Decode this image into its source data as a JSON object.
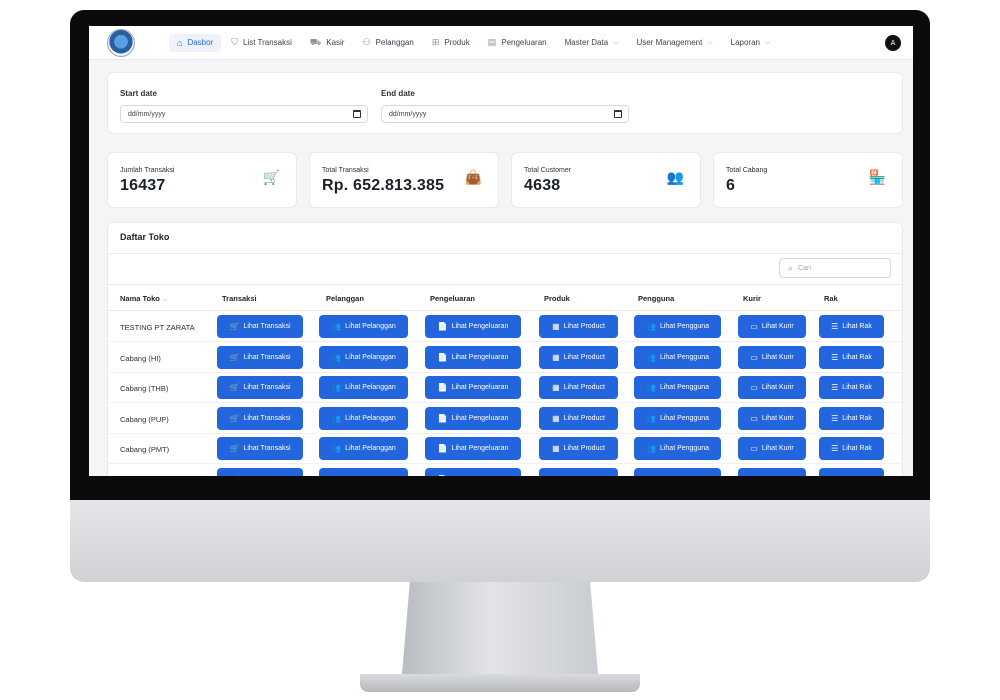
{
  "nav": {
    "items": [
      {
        "label": "Dasbor",
        "icon": "home-icon",
        "glyph": "⌂",
        "active": true,
        "dropdown": false
      },
      {
        "label": "List Transaksi",
        "icon": "bag-icon",
        "glyph": "⛉",
        "active": false,
        "dropdown": false
      },
      {
        "label": "Kasir",
        "icon": "cart-icon",
        "glyph": "⛟",
        "active": false,
        "dropdown": false
      },
      {
        "label": "Pelanggan",
        "icon": "users-icon",
        "glyph": "⚇",
        "active": false,
        "dropdown": false
      },
      {
        "label": "Produk",
        "icon": "grid-icon",
        "glyph": "⊞",
        "active": false,
        "dropdown": false
      },
      {
        "label": "Pengeluaran",
        "icon": "file-icon",
        "glyph": "▤",
        "active": false,
        "dropdown": false
      },
      {
        "label": "Master Data",
        "icon": "",
        "glyph": "",
        "active": false,
        "dropdown": true
      },
      {
        "label": "User Management",
        "icon": "",
        "glyph": "",
        "active": false,
        "dropdown": true
      },
      {
        "label": "Laporan",
        "icon": "",
        "glyph": "",
        "active": false,
        "dropdown": true
      }
    ],
    "avatar": "A"
  },
  "filters": {
    "start_label": "Start date",
    "start_placeholder": "dd/mm/yyyy",
    "end_label": "End date",
    "end_placeholder": "dd/mm/yyyy"
  },
  "stats": [
    {
      "label": "Jumlah Transaksi",
      "value": "16437",
      "icon": "cart-icon",
      "glyph": "🛒"
    },
    {
      "label": "Total Transaksi",
      "value": "Rp. 652.813.385",
      "icon": "bag-icon",
      "glyph": "👜"
    },
    {
      "label": "Total Customer",
      "value": "4638",
      "icon": "users-icon",
      "glyph": "👥"
    },
    {
      "label": "Total Cabang",
      "value": "6",
      "icon": "store-icon",
      "glyph": "🏪"
    }
  ],
  "accent_color": "#2265dc",
  "stat_icon_color": "#22b35e",
  "toko": {
    "title": "Daftar Toko",
    "search_placeholder": "Cari",
    "columns": [
      "Nama Toko",
      "Transaksi",
      "Pelanggan",
      "Pengeluaran",
      "Produk",
      "Pengguna",
      "Kurir",
      "Rak"
    ],
    "buttons": [
      {
        "label": "Lihat Transaksi",
        "glyph": "🛒"
      },
      {
        "label": "Lihat Pelanggan",
        "glyph": "👥"
      },
      {
        "label": "Lihat Pengeluaran",
        "glyph": "📄"
      },
      {
        "label": "Lihat Product",
        "glyph": "▦"
      },
      {
        "label": "Lihat Pengguna",
        "glyph": "👥"
      },
      {
        "label": "Lihat Kurir",
        "glyph": "▭"
      },
      {
        "label": "Lihat Rak",
        "glyph": "☰"
      }
    ],
    "rows": [
      {
        "name": "TESTING PT ZARATA"
      },
      {
        "name": "Cabang (HI)"
      },
      {
        "name": "Cabang (THB)"
      },
      {
        "name": "Cabang (PUP)"
      },
      {
        "name": "Cabang (PMT)"
      },
      {
        "name": ""
      }
    ]
  }
}
